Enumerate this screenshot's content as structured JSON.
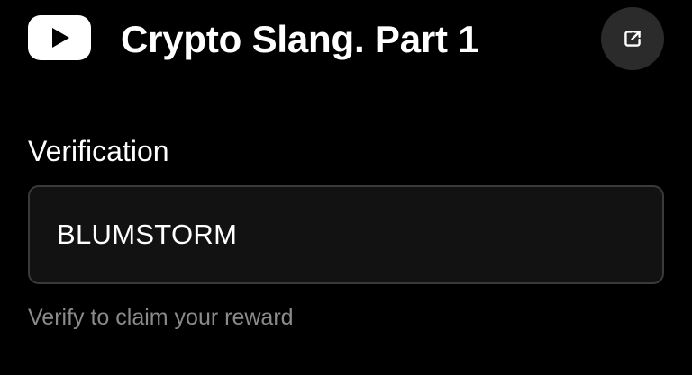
{
  "header": {
    "brand_icon": "youtube-play-icon",
    "title": "Crypto Slang. Part 1",
    "open_link_icon": "external-link-icon"
  },
  "verification": {
    "label": "Verification",
    "input_value": "BLUMSTORM",
    "helper_text": "Verify to claim your reward"
  },
  "colors": {
    "background": "#000000",
    "text_primary": "#ffffff",
    "text_secondary": "#8a8a8a",
    "field_background": "#121212",
    "field_border": "#3a3a3a",
    "icon_button_background": "#2b2b2b"
  }
}
